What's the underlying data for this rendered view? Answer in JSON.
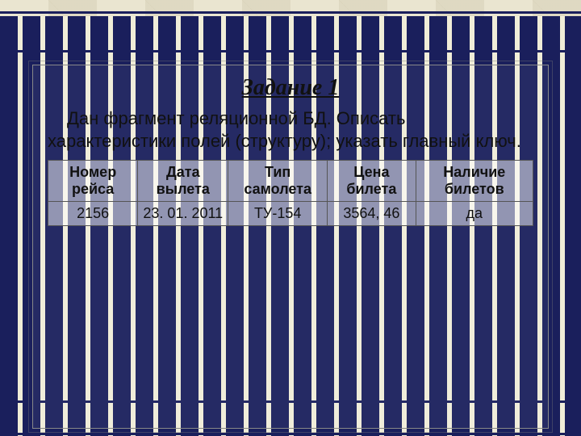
{
  "title": "Задание 1",
  "task_text": "Дан фрагмент реляционной БД. Описать характеристики полей (структуру); указать главный ключ.",
  "table": {
    "headers": [
      "Номер рейса",
      "Дата вылета",
      "Тип самолета",
      "Цена билета",
      "Наличие билетов"
    ],
    "rows": [
      [
        "2156",
        "23. 01. 2011",
        "ТУ-154",
        "3564, 46",
        "да"
      ]
    ]
  }
}
